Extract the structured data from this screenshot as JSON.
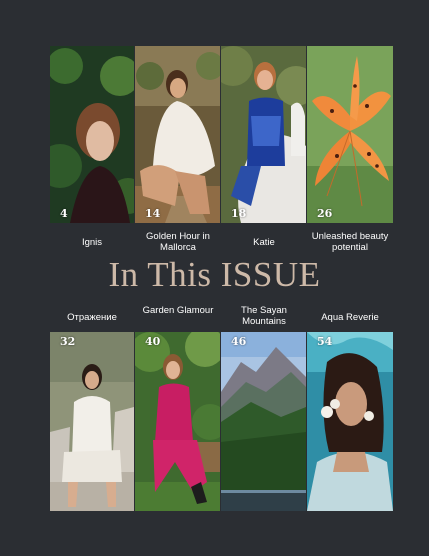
{
  "headline": "In This ISSUE",
  "top_row": [
    {
      "page": "4",
      "title": "Ignis"
    },
    {
      "page": "14",
      "title": "Golden Hour in Mallorca"
    },
    {
      "page": "18",
      "title": "Katie"
    },
    {
      "page": "26",
      "title": "Unleashed beauty potential"
    }
  ],
  "bottom_row": [
    {
      "page": "32",
      "title": "Отражение"
    },
    {
      "page": "40",
      "title": "Garden Glamour"
    },
    {
      "page": "46",
      "title": "The Sayan Mountains"
    },
    {
      "page": "54",
      "title": "Aqua Reverie"
    }
  ],
  "colors": {
    "background": "#2b2e33",
    "headline": "#cdb9a8",
    "text": "#ffffff"
  }
}
